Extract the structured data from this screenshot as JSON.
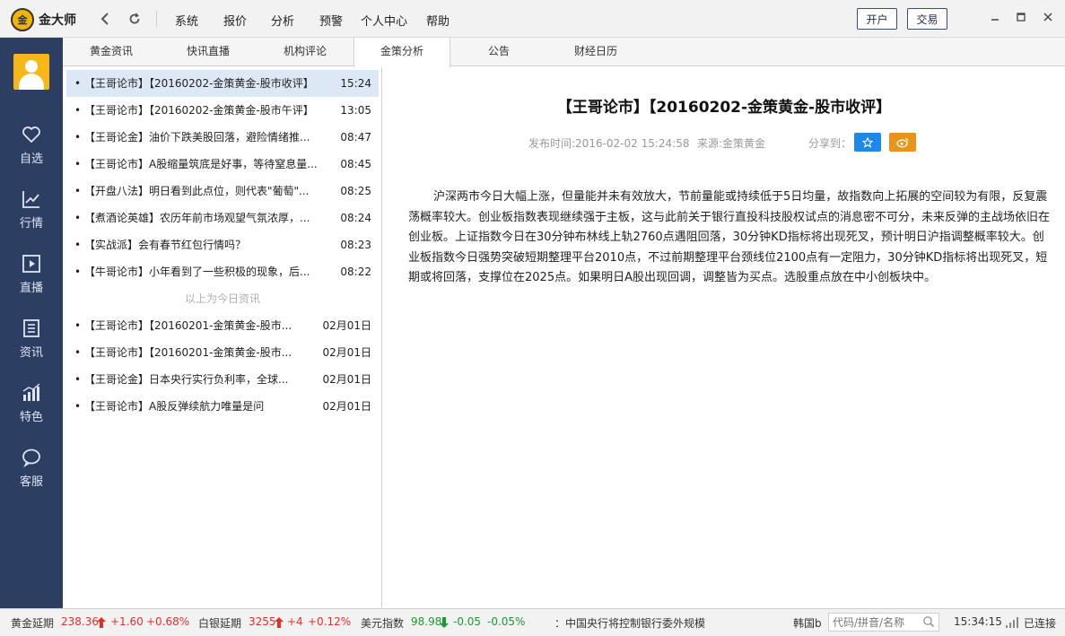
{
  "app": {
    "name": "金大师",
    "logo_mark": "金"
  },
  "menu": [
    "系统",
    "报价",
    "分析",
    "预警",
    "个人中心",
    "帮助"
  ],
  "toolbar": {
    "open_account": "开户",
    "trade": "交易"
  },
  "sidebar": {
    "items": [
      {
        "label": "自选",
        "icon": "heart-icon"
      },
      {
        "label": "行情",
        "icon": "trend-chart-icon"
      },
      {
        "label": "直播",
        "icon": "play-icon"
      },
      {
        "label": "资讯",
        "icon": "news-icon"
      },
      {
        "label": "特色",
        "icon": "bar-chart-icon"
      },
      {
        "label": "客服",
        "icon": "chat-bubble-icon"
      }
    ]
  },
  "tabs": [
    "黄金资讯",
    "快讯直播",
    "机构评论",
    "金策分析",
    "公告",
    "财经日历"
  ],
  "active_tab": "金策分析",
  "list": {
    "today": [
      {
        "title": "【王哥论市】【20160202-金策黄金-股市收评】",
        "time": "15:24",
        "selected": true
      },
      {
        "title": "【王哥论市】【20160202-金策黄金-股市午评】",
        "time": "13:05"
      },
      {
        "title": "【王哥论金】油价下跌美股回落，避险情绪推...",
        "time": "08:47"
      },
      {
        "title": "【王哥论市】A股缩量筑底是好事，等待窒息量...",
        "time": "08:45"
      },
      {
        "title": "【开盘八法】明日看到此点位，则代表\"葡萄\"...",
        "time": "08:25"
      },
      {
        "title": "【煮酒论英雄】农历年前市场观望气氛浓厚，...",
        "time": "08:24"
      },
      {
        "title": "【实战派】会有春节红包行情吗？",
        "time": "08:23"
      },
      {
        "title": "【牛哥论市】小年看到了一些积极的现象，后...",
        "time": "08:22"
      }
    ],
    "divider": "以上为今日资讯",
    "earlier": [
      {
        "title": "【王哥论市】【20160201-金策黄金-股市...",
        "time": "02月01日"
      },
      {
        "title": "【王哥论市】【20160201-金策黄金-股市...",
        "time": "02月01日"
      },
      {
        "title": "【王哥论金】日本央行实行负利率，全球...",
        "time": "02月01日"
      },
      {
        "title": "【王哥论市】A股反弹续航力唯量是问",
        "time": "02月01日"
      }
    ]
  },
  "article": {
    "title": "【王哥论市】【20160202-金策黄金-股市收评】",
    "publish_time": "发布时间:2016-02-02 15:24:58",
    "source": "来源:金策黄金",
    "share_label": "分享到：",
    "body": "沪深两市今日大幅上涨，但量能并未有效放大，节前量能或持续低于5日均量，故指数向上拓展的空间较为有限，反复震荡概率较大。创业板指数表现继续强于主板，这与此前关于银行直投科技股权试点的消息密不可分，未来反弹的主战场依旧在创业板。上证指数今日在30分钟布林线上轨2760点遇阻回落，30分钟KD指标将出现死叉，预计明日沪指调整概率较大。创业板指数今日强势突破短期整理平台2010点，不过前期整理平台颈线位2100点有一定阻力，30分钟KD指标将出现死叉，短期或将回落，支撑位在2025点。如果明日A股出现回调，调整皆为买点。选股重点放在中小创板块中。"
  },
  "statusbar": {
    "gold": {
      "name": "黄金延期",
      "price": "238.36",
      "change": "+1.60",
      "pct": "+0.68%"
    },
    "silver": {
      "name": "白银延期",
      "price": "3255",
      "change": "+4",
      "pct": "+0.12%"
    },
    "usd": {
      "name": "美元指数",
      "price": "98.98",
      "change": "-0.05",
      "pct": "-0.05%"
    },
    "ticker": "：中国央行将控制银行委外规模",
    "ticker_right": "韩国b",
    "search_placeholder": "代码/拼音/名称",
    "clock": "15:34:15",
    "connection": "已连接"
  },
  "colors": {
    "sidebar": "#2d3e63",
    "up": "#e0302a",
    "down": "#1d9a2f",
    "share_favorite": "#1e88e5",
    "share_weibo": "#e8941a"
  }
}
